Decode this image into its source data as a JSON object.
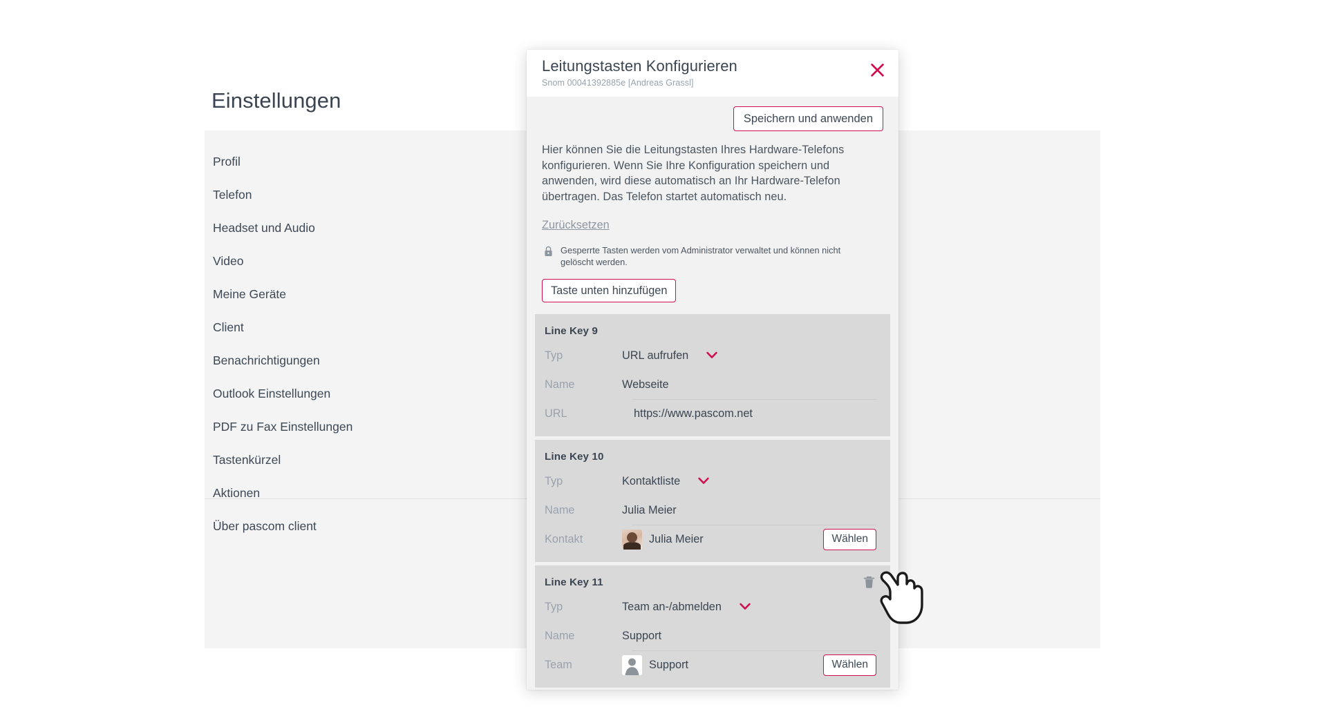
{
  "page": {
    "title": "Einstellungen",
    "nav_items": [
      {
        "label": "Profil"
      },
      {
        "label": "Telefon"
      },
      {
        "label": "Headset und Audio"
      },
      {
        "label": "Video"
      },
      {
        "label": "Meine Geräte"
      },
      {
        "label": "Client"
      },
      {
        "label": "Benachrichtigungen"
      },
      {
        "label": "Outlook Einstellungen"
      },
      {
        "label": "PDF zu Fax Einstellungen"
      },
      {
        "label": "Tastenkürzel"
      },
      {
        "label": "Aktionen"
      },
      {
        "label": "Über pascom client"
      }
    ]
  },
  "dialog": {
    "title": "Leitungstasten Konfigurieren",
    "subtitle": "Snom 00041392885e [Andreas Grassl]",
    "close_icon": "close-icon",
    "save_apply_label": "Speichern und anwenden",
    "description": "Hier können Sie die Leitungstasten Ihres Hardware-Telefons konfigurieren. Wenn Sie Ihre Konfiguration speichern und anwenden, wird diese automatisch an Ihr Hardware-Telefon übertragen. Das Telefon startet automatisch neu.",
    "reset_label": "Zurücksetzen",
    "lock_icon": "lock-icon",
    "lock_note": "Gesperrte Tasten werden vom Administrator verwaltet und können nicht gelöscht werden.",
    "add_key_label": "Taste unten hinzufügen",
    "choose_label": "Wählen",
    "trash_icon": "trash-icon",
    "caret_icon": "chevron-down-icon",
    "labels": {
      "typ": "Typ",
      "name": "Name",
      "url": "URL",
      "kontakt": "Kontakt",
      "team": "Team"
    },
    "keys": [
      {
        "title": "Line Key 9",
        "typ": "URL aufrufen",
        "name": "Webseite",
        "third_label": "URL",
        "third_value": "https://www.pascom.net",
        "third_kind": "text",
        "deletable": false
      },
      {
        "title": "Line Key 10",
        "typ": "Kontaktliste",
        "name": "Julia Meier",
        "third_label": "Kontakt",
        "third_value": "Julia Meier",
        "third_kind": "contact-photo",
        "deletable": false
      },
      {
        "title": "Line Key 11",
        "typ": "Team an-/abmelden",
        "name": "Support",
        "third_label": "Team",
        "third_value": "Support",
        "third_kind": "contact-generic",
        "deletable": true
      }
    ]
  },
  "colors": {
    "accent": "#cf0f4e",
    "text": "#3b4551",
    "muted": "#9aa2ad",
    "panel_bg": "#f4f4f4",
    "dialog_body_bg": "#f2f2f2",
    "card_bg": "#d9d9d9"
  },
  "cursor": {
    "icon": "hand-pointer-cursor"
  }
}
